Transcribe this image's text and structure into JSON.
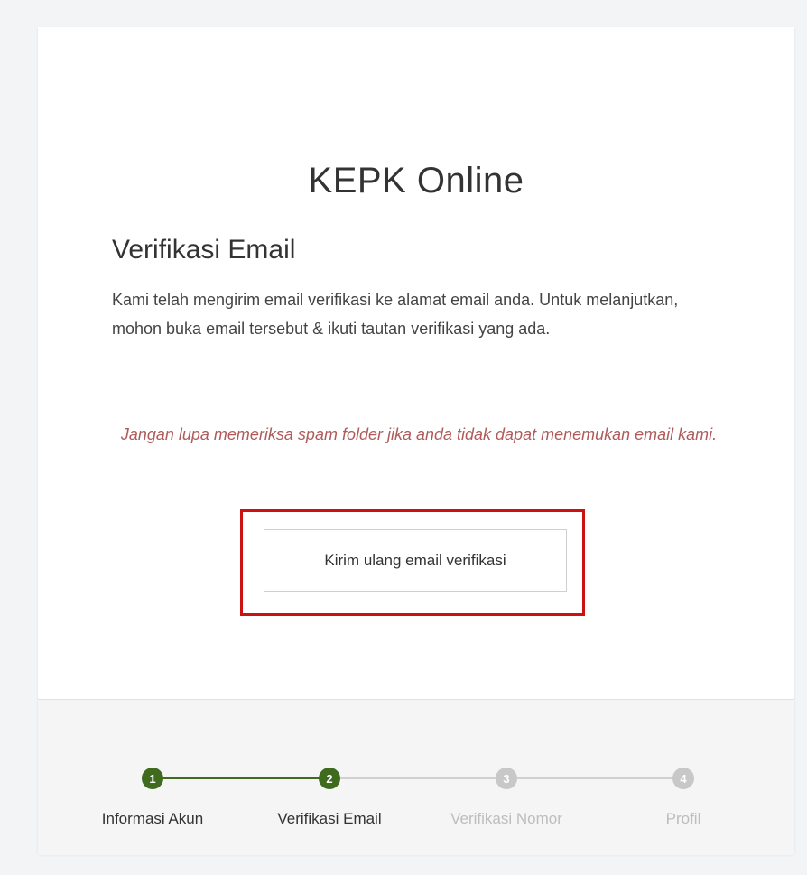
{
  "app_title": "KEPK Online",
  "heading": "Verifikasi Email",
  "message": "Kami telah mengirim email verifikasi ke alamat email anda. Untuk melanjutkan, mohon buka email tersebut & ikuti tautan verifikasi yang ada.",
  "spam_note": "Jangan lupa memeriksa spam folder jika anda tidak dapat menemukan email kami.",
  "resend_button_label": "Kirim ulang email verifikasi",
  "colors": {
    "step_active": "#3f6b1f",
    "step_inactive": "#c8c8c8",
    "highlight_box": "#cc1111",
    "note_text": "#b05a5a"
  },
  "steps": [
    {
      "number": "1",
      "label": "Informasi Akun",
      "state": "completed"
    },
    {
      "number": "2",
      "label": "Verifikasi Email",
      "state": "active"
    },
    {
      "number": "3",
      "label": "Verifikasi Nomor",
      "state": "pending"
    },
    {
      "number": "4",
      "label": "Profil",
      "state": "pending"
    }
  ]
}
